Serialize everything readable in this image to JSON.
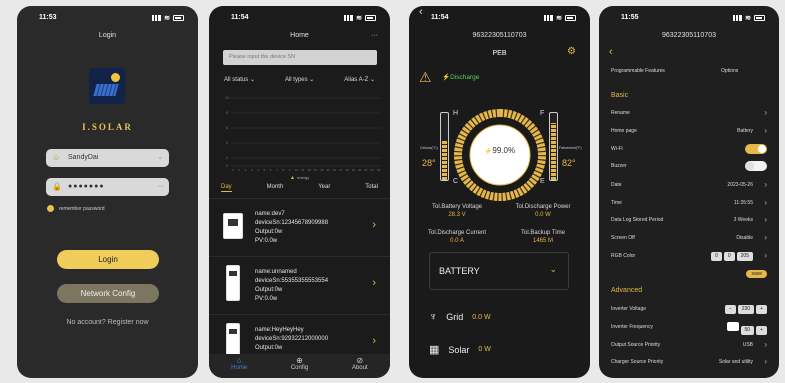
{
  "login": {
    "time": "11:53",
    "title": "Login",
    "brand": "I.SOLAR",
    "username": "SandyDai",
    "password_mask": "●●●●●●●",
    "remember": "remember password",
    "login_btn": "Login",
    "network_btn": "Network Config",
    "register": "No account? Register now"
  },
  "home": {
    "time": "11:54",
    "title": "Home",
    "search_placeholder": "Please input the device SN",
    "filters": [
      "All status",
      "All types",
      "Alias A-Z"
    ],
    "legend": "energy",
    "date_tabs": [
      "Day",
      "Month",
      "Year",
      "Total"
    ],
    "devices": [
      {
        "name": "name:dev7",
        "sn": "deviceSn:12345678909988",
        "output": "Output:0w",
        "pv": "PV:0.0w"
      },
      {
        "name": "name:unnamed",
        "sn": "deviceSn:55355355553554",
        "output": "Output:0w",
        "pv": "PV:0.0w"
      },
      {
        "name": "name:HeyHeyHey",
        "sn": "deviceSn:92932212000000",
        "output": "Output:0w",
        "pv": ""
      }
    ],
    "tabs": [
      "Home",
      "Config",
      "About"
    ]
  },
  "peb": {
    "time": "11:54",
    "serial": "96322305110703",
    "title": "PEB",
    "state": "Discharge",
    "h": "H",
    "c": "C",
    "f": "F",
    "e": "E",
    "left_temp": "28°",
    "right_temp": "82°",
    "left_sub": "Celsius(°C)",
    "right_sub": "Fahrenheit(°F)",
    "soc": "99.0%",
    "soc_value": 99,
    "stats": [
      {
        "label": "Tol.Battery Voltage",
        "value": "28.3 V"
      },
      {
        "label": "Tol.Discharge Power",
        "value": "0.0 W"
      },
      {
        "label": "Tol.Discharge Current",
        "value": "0.0 A"
      },
      {
        "label": "Tol.Backup Time",
        "value": "1465 M"
      }
    ],
    "battery_label": "BATTERY",
    "grid_label": "Grid",
    "grid_value": "0.0 W",
    "solar_label": "Solar",
    "solar_value": "0 W"
  },
  "settings": {
    "time": "11:55",
    "serial": "96322305110703",
    "header_left": "Programmable Features",
    "header_right": "Options",
    "basic": "Basic",
    "advanced": "Advanced",
    "rows": {
      "rename": "Rename",
      "home_page": "Home page",
      "home_page_val": "Battery",
      "wifi": "Wi-Fi",
      "buzzer": "Buzzer",
      "date": "Date",
      "date_val": "2023-05-26",
      "time_lbl": "Time",
      "time_val": "11:35:55",
      "datalog": "Data Log Stored Period",
      "datalog_val": "3 Weeks",
      "screen_off": "Screen Off",
      "screen_off_val": "Disable",
      "rgb": "RGB Color",
      "rgb_vals": [
        "0",
        "0",
        "205"
      ],
      "save": "save",
      "inv_voltage": "Inverter Voltage",
      "inv_voltage_val": "230",
      "inv_freq": "Inverter Frequency",
      "inv_freq_val": "50",
      "output_src": "Output Source Priority",
      "output_src_val": "USB",
      "charger_src": "Charger Source Priority",
      "charger_src_val": "Solar and utility"
    }
  }
}
